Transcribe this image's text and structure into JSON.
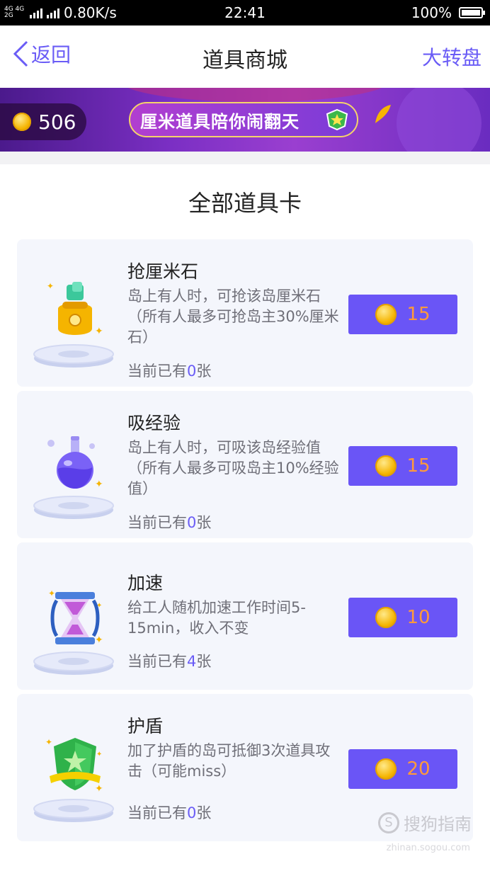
{
  "status_bar": {
    "network": "4G 4G 2G",
    "speed": "0.80K/s",
    "time": "22:41",
    "battery": "100%"
  },
  "nav": {
    "back_label": "返回",
    "title": "道具商城",
    "right_label": "大转盘"
  },
  "banner": {
    "coin_balance": "506",
    "slogan": "厘米道具陪你闹翻天"
  },
  "section_title": "全部道具卡",
  "owned_prefix": "当前已有",
  "owned_suffix": "张",
  "items": [
    {
      "name": "抢厘米石",
      "desc": "岛上有人时，可抢该岛厘米石（所有人最多可抢岛主30%厘米石）",
      "owned": "0",
      "price": "15",
      "icon": "money-bag-icon"
    },
    {
      "name": "吸经验",
      "desc": "岛上有人时，可吸该岛经验值（所有人最多可吸岛主10%经验值）",
      "owned": "0",
      "price": "15",
      "icon": "potion-flask-icon"
    },
    {
      "name": "加速",
      "desc": "给工人随机加速工作时间5-15min，收入不变",
      "owned": "4",
      "price": "10",
      "icon": "hourglass-icon"
    },
    {
      "name": "护盾",
      "desc": "加了护盾的岛可抵御3次道具攻击（可能miss）",
      "owned": "0",
      "price": "20",
      "icon": "shield-star-icon"
    }
  ],
  "watermark": {
    "text": "搜狗指南",
    "url": "zhinan.sogou.com"
  },
  "colors": {
    "accent": "#6a55f6",
    "price": "#ff9a3a",
    "card_bg": "#f4f6fc"
  }
}
